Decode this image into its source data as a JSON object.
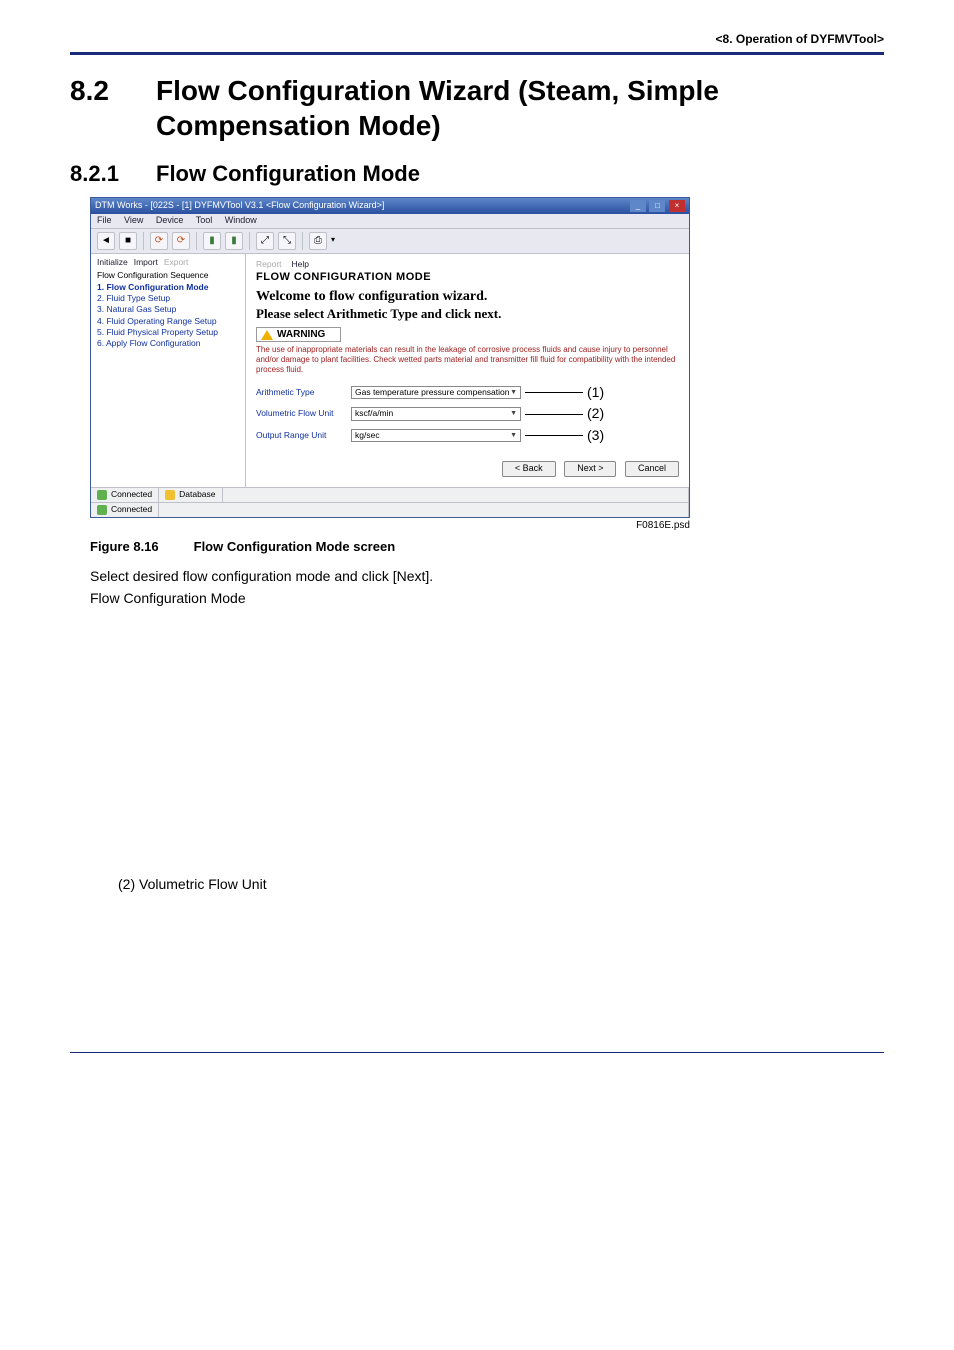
{
  "header": {
    "text": "<8.  Operation of DYFMVTool>"
  },
  "section": {
    "number": "8.2",
    "title": "Flow Configuration Wizard (Steam, Simple Compensation Mode)"
  },
  "subsection": {
    "number": "8.2.1",
    "title": "Flow Configuration Mode"
  },
  "app": {
    "title": "DTM Works - [022S - [1] DYFMVTool V3.1 <Flow Configuration Wizard>]",
    "menus": [
      "File",
      "View",
      "Device",
      "Tool",
      "Window"
    ],
    "sidebar_tabs": {
      "initialize": "Initialize",
      "import": "Import",
      "export": "Export"
    },
    "main_tabs": {
      "report": "Report",
      "help": "Help"
    },
    "seq_title": "Flow Configuration Sequence",
    "steps": [
      "1. Flow Configuration Mode",
      "2. Fluid Type Setup",
      "3. Natural Gas Setup",
      "4. Fluid Operating Range Setup",
      "5. Fluid Physical Property Setup",
      "6. Apply Flow Configuration"
    ],
    "pane_title": "FLOW CONFIGURATION MODE",
    "welcome": "Welcome to flow configuration  wizard.",
    "please": "Please select Arithmetic Type and click next.",
    "warning_label": "WARNING",
    "warning_text": "The use of inappropriate materials can result in the leakage of corrosive process fluids and cause injury to personnel and/or damage to plant facilities. Check wetted parts material and transmitter fill fluid for compatibility with the intended process fluid.",
    "fields": {
      "arithmetic": {
        "label": "Arithmetic Type",
        "value": "Gas temperature pressure compensation",
        "callout": "(1)"
      },
      "volumetric": {
        "label": "Volumetric Flow Unit",
        "value": "kscf/a/min",
        "callout": "(2)"
      },
      "output": {
        "label": "Output Range Unit",
        "value": "kg/sec",
        "callout": "(3)"
      }
    },
    "buttons": {
      "back": "< Back",
      "next": "Next >",
      "cancel": "Cancel"
    },
    "status": {
      "connected": "Connected",
      "database": "Database"
    },
    "fig_source": "F0816E.psd"
  },
  "figure": {
    "label": "Figure 8.16",
    "caption": "Flow Configuration Mode screen"
  },
  "body": {
    "line1": "Select desired flow configuration mode and click [Next].",
    "line2": "Flow Configuration Mode",
    "item2": "(2) Volumetric Flow Unit"
  }
}
